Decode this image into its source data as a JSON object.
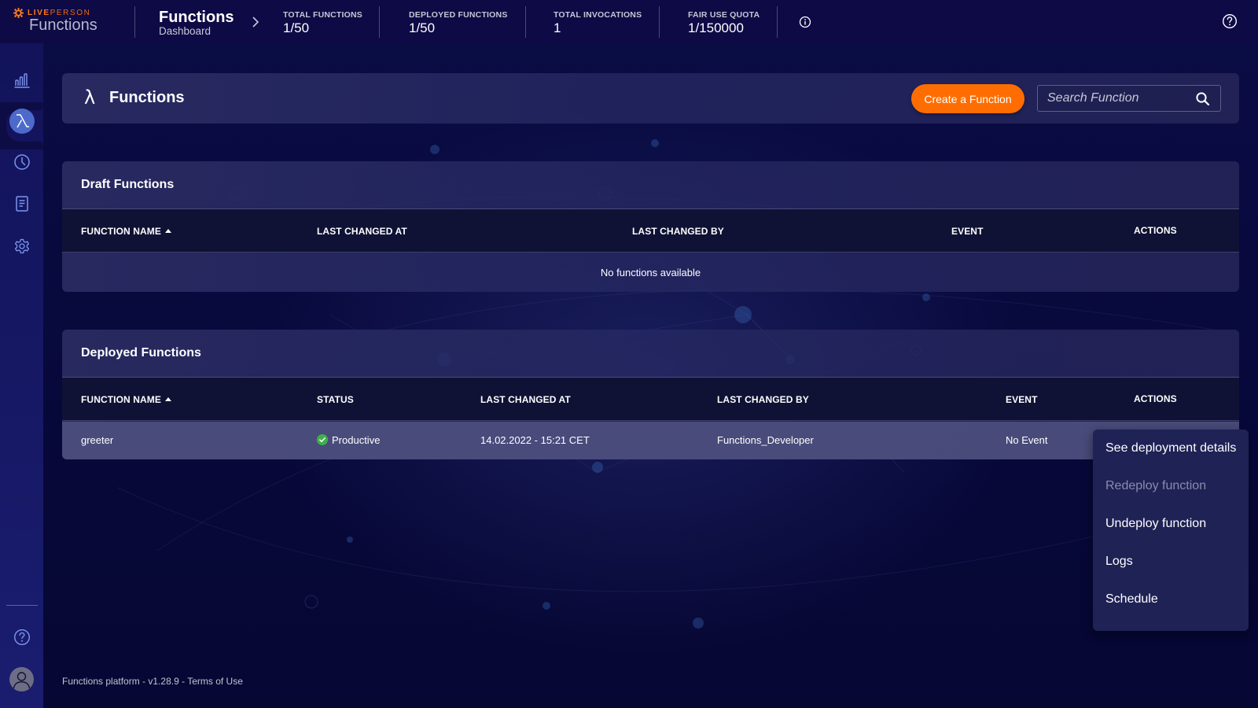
{
  "app": {
    "brand_bold": "LIVE",
    "brand_light": "PERSON",
    "product_name": "Functions",
    "brand_color": "#ff6d00"
  },
  "breadcrumb": {
    "title": "Functions",
    "subtitle": "Dashboard"
  },
  "stats": [
    {
      "label": "TOTAL FUNCTIONS",
      "value": "1/50"
    },
    {
      "label": "DEPLOYED FUNCTIONS",
      "value": "1/50"
    },
    {
      "label": "TOTAL INVOCATIONS",
      "value": "1"
    },
    {
      "label": "FAIR USE QUOTA",
      "value": "1/150000"
    }
  ],
  "topbar_icons": {
    "info": "info-icon",
    "help": "help-icon"
  },
  "sidebar": {
    "items": [
      {
        "name": "analytics",
        "icon": "bar-chart-icon",
        "active": false
      },
      {
        "name": "functions",
        "icon": "lambda-icon",
        "active": true
      },
      {
        "name": "history",
        "icon": "clock-icon",
        "active": false
      },
      {
        "name": "documentation",
        "icon": "document-icon",
        "active": false
      },
      {
        "name": "settings",
        "icon": "gear-icon",
        "active": false
      }
    ],
    "bottom": [
      {
        "name": "help",
        "icon": "help-icon"
      },
      {
        "name": "profile",
        "icon": "user-avatar-icon"
      }
    ]
  },
  "page_header": {
    "icon": "λ",
    "title": "Functions",
    "create_button": "Create a Function",
    "search_placeholder": "Search Function",
    "search_value": ""
  },
  "draft_functions": {
    "title": "Draft Functions",
    "columns": [
      "FUNCTION NAME",
      "LAST CHANGED AT",
      "LAST CHANGED BY",
      "EVENT",
      "ACTIONS"
    ],
    "sorted_column": "FUNCTION NAME",
    "sort_direction": "asc",
    "rows": [],
    "empty_message": "No functions available"
  },
  "deployed_functions": {
    "title": "Deployed Functions",
    "columns": [
      "FUNCTION NAME",
      "STATUS",
      "LAST CHANGED AT",
      "LAST CHANGED BY",
      "EVENT",
      "ACTIONS"
    ],
    "sorted_column": "FUNCTION NAME",
    "sort_direction": "asc",
    "rows": [
      {
        "name": "greeter",
        "status": "Productive",
        "status_color": "#3cb14a",
        "last_changed_at": "14.02.2022 - 15:21 CET",
        "last_changed_by": "Functions_Developer",
        "event": "No Event"
      }
    ]
  },
  "actions_menu": {
    "items": [
      {
        "label": "See deployment details",
        "enabled": true
      },
      {
        "label": "Redeploy function",
        "enabled": false
      },
      {
        "label": "Undeploy function",
        "enabled": true
      },
      {
        "label": "Logs",
        "enabled": true
      },
      {
        "label": "Schedule",
        "enabled": true
      }
    ]
  },
  "footer": {
    "platform": "Functions platform",
    "version": "v1.28.9",
    "separator": " - ",
    "terms_link": "Terms of Use"
  }
}
